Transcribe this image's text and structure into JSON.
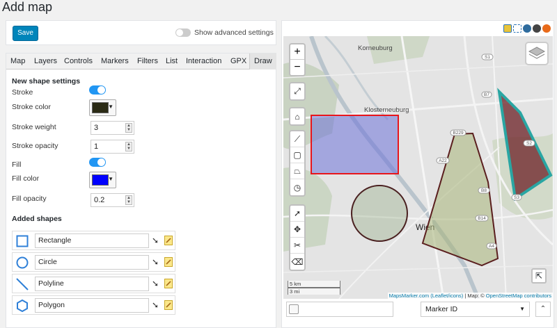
{
  "page": {
    "title": "Add map"
  },
  "toolbar": {
    "save_label": "Save",
    "advanced_label": "Show advanced settings"
  },
  "tabs": [
    "Map",
    "Layers",
    "Controls",
    "Markers",
    "Filters",
    "List",
    "Interaction",
    "GPX",
    "Draw"
  ],
  "draw": {
    "section_title": "New shape settings",
    "stroke_label": "Stroke",
    "stroke_on": true,
    "stroke_color_label": "Stroke color",
    "stroke_color": "#2a2a14",
    "stroke_weight_label": "Stroke weight",
    "stroke_weight": "3",
    "stroke_opacity_label": "Stroke opacity",
    "stroke_opacity": "1",
    "fill_label": "Fill",
    "fill_on": true,
    "fill_color_label": "Fill color",
    "fill_color": "#0000ff",
    "fill_opacity_label": "Fill opacity",
    "fill_opacity": "0.2",
    "added_title": "Added shapes",
    "shapes": [
      {
        "name": "Rectangle",
        "icon": "rectangle-icon"
      },
      {
        "name": "Circle",
        "icon": "circle-icon"
      },
      {
        "name": "Polyline",
        "icon": "polyline-icon"
      },
      {
        "name": "Polygon",
        "icon": "polygon-icon"
      }
    ]
  },
  "map": {
    "zoom_in": "+",
    "zoom_out": "−",
    "places": [
      "Korneuburg",
      "Klosterneuburg",
      "Wien"
    ],
    "roads": [
      "S1",
      "B7",
      "S2",
      "B229",
      "A22",
      "B8",
      "S3",
      "B14",
      "A4"
    ],
    "scale_km": "5 km",
    "scale_mi": "3 mi",
    "attribution_link": "MapsMarker.com (Leaflet/icons)",
    "attribution_text": " | Map: © ",
    "attribution_osm": "OpenStreetMap contributors",
    "search_placeholder": "",
    "sort_select": "Marker ID"
  },
  "colors": {
    "accent": "#0085ba",
    "toggle_on": "#2196f3",
    "rect_stroke": "#e8151b",
    "rect_fill": "#6e72d8",
    "circle_stroke": "#4a2020",
    "circle_fill": "#8da57a",
    "polygon_stroke": "#5a1e1e",
    "polygon_fill": "#a8b479",
    "triangle_stroke": "#2aa6a3",
    "triangle_fill": "#6b1f24"
  }
}
